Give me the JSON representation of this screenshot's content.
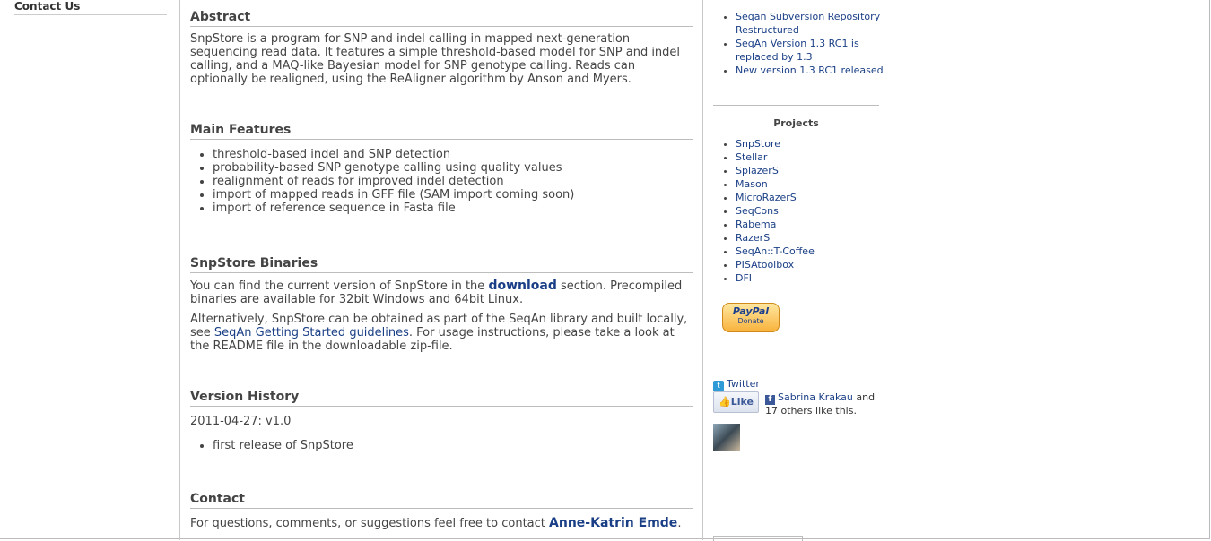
{
  "left_nav": {
    "contact_us": "Contact Us"
  },
  "abstract": {
    "title": "Abstract",
    "body": "SnpStore is a program for SNP and indel calling in mapped next-generation sequencing read data. It features a simple threshold-based model for SNP and indel calling, and a MAQ-like Bayesian model for SNP genotype calling. Reads can optionally be realigned, using the ReAligner algorithm by Anson and Myers."
  },
  "features": {
    "title": "Main Features",
    "items": [
      "threshold-based indel and SNP detection",
      "probability-based SNP genotype calling using quality values",
      "realignment of reads for improved indel detection",
      "import of mapped reads in GFF file (SAM import coming soon)",
      "import of reference sequence in Fasta file"
    ]
  },
  "binaries": {
    "title": "SnpStore Binaries",
    "p1_before": "You can find the current version of SnpStore in the ",
    "p1_link": "download",
    "p1_after": " section. Precompiled binaries are available for 32bit Windows and 64bit Linux.",
    "p2_before": "Alternatively, SnpStore can be obtained as part of the SeqAn library and built locally, see ",
    "p2_link": "SeqAn Getting Started guidelines",
    "p2_after": ". For usage instructions, please take a look at the README file in the downloadable zip-file."
  },
  "history": {
    "title": "Version History",
    "version_line": "2011-04-27: v1.0",
    "items": [
      "first release of SnpStore"
    ]
  },
  "contact": {
    "title": "Contact",
    "text_before": "For questions, comments, or suggestions feel free to contact ",
    "link": "Anne-Katrin Emde",
    "text_after": "."
  },
  "sidebar": {
    "news": [
      "Seqan Subversion Repository Restructured",
      "SeqAn Version 1.3 RC1 is replaced by 1.3",
      "New version 1.3 RC1 released"
    ],
    "projects_title": "Projects",
    "projects": [
      "SnpStore",
      "Stellar",
      "SplazerS",
      "Mason",
      "MicroRazerS",
      "SeqCons",
      "Rabema",
      "RazerS",
      "SeqAn::T-Coffee",
      "PISAtoolbox",
      "DFI"
    ],
    "paypal_logo": "PayPal",
    "paypal_label": "Donate",
    "twitter_label": "Twitter",
    "like_label": "Like",
    "like_name": "Sabrina Krakau",
    "like_rest": " and 17 others like this."
  }
}
